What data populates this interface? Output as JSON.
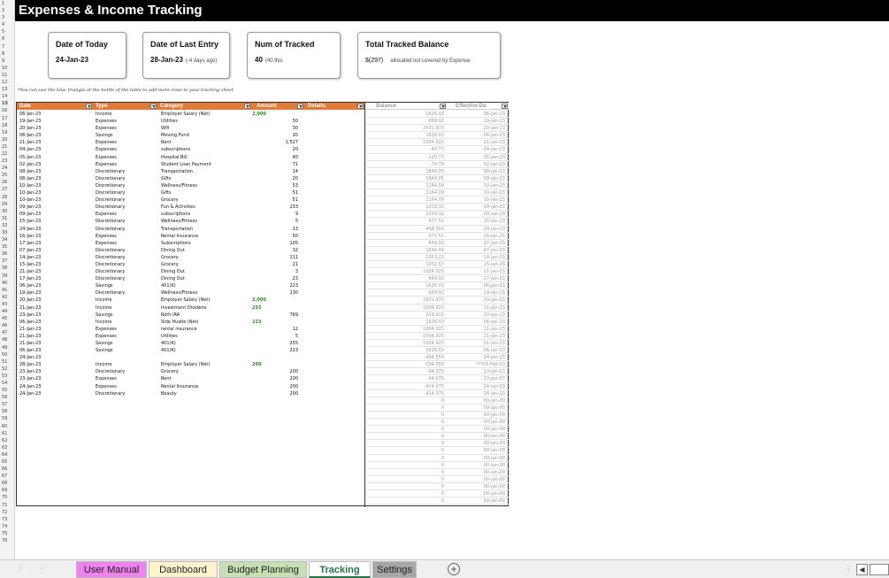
{
  "title": "Expenses & Income Tracking",
  "row_numbers": [
    "1",
    "2",
    "3",
    "4",
    "5",
    "6",
    "7",
    "8",
    "9",
    "10",
    "11",
    "12",
    "13",
    "14",
    "15",
    "16",
    "17",
    "18",
    "19",
    "20",
    "21",
    "22",
    "23",
    "24",
    "25",
    "26",
    "27",
    "28",
    "29",
    "30",
    "31",
    "32",
    "33",
    "34",
    "35",
    "36",
    "37",
    "38",
    "39",
    "40",
    "41",
    "42",
    "43",
    "44",
    "45",
    "46",
    "47",
    "48",
    "49",
    "50",
    "51",
    "52",
    "53",
    "54",
    "55",
    "56",
    "57",
    "58",
    "59",
    "60",
    "61",
    "62",
    "63",
    "64",
    "65",
    "66",
    "67",
    "68",
    "69",
    "70",
    "71",
    "72",
    "73",
    "74",
    "75",
    "76"
  ],
  "cards": {
    "today": {
      "label": "Date of Today",
      "value": "24-Jan-23"
    },
    "last_entry": {
      "label": "Date of Last Entry",
      "value": "28-Jan-23",
      "sub": "(-4 days ago)"
    },
    "num_tracked": {
      "label": "Num of Tracked",
      "value": "40",
      "sub": "(40 this"
    },
    "balance": {
      "label": "Total Tracked Balance",
      "value": "$(297)",
      "sub": "allocated not covered by Expense"
    }
  },
  "note": "*You can use the blue triangle at the bottle of the table to add more rows to your tracking sheet",
  "table": {
    "headers": {
      "date": "Date",
      "type": "Type",
      "category": "Category",
      "amount": "Amount",
      "details": "Details",
      "balance": "Balance",
      "effective": "Effective Da"
    },
    "header_colors": {
      "main": "#e07b39",
      "aux": "#ffffff"
    },
    "rows": [
      {
        "date": "06-Jan-23",
        "type": "Income",
        "category": "Employer Salary (Net)",
        "amount": "2,000",
        "income": true,
        "balance": "1626.03",
        "effective": "06-Jan-23"
      },
      {
        "date": "19-Jan-23",
        "type": "Expenses",
        "category": "Utilities",
        "amount": "50",
        "balance": "669.92",
        "effective": "19-Jan-23"
      },
      {
        "date": "20-Jan-23",
        "type": "Expenses",
        "category": "Wifi",
        "amount": "30",
        "balance": "2631.975",
        "effective": "20-Jan-23"
      },
      {
        "date": "06-Jan-23",
        "type": "Savings",
        "category": "Moving Fund",
        "amount": "20",
        "balance": "1626.03",
        "effective": "06-Jan-23"
      },
      {
        "date": "21-Jan-23",
        "type": "Expenses",
        "category": "Rent",
        "amount": "1,527",
        "balance": "1004.925",
        "effective": "21-Jan-23"
      },
      {
        "date": "04-Jan-23",
        "type": "Expenses",
        "category": "subscriptions",
        "amount": "20",
        "balance": "-40.73",
        "effective": "04-Jan-23"
      },
      {
        "date": "05-Jan-23",
        "type": "Expenses",
        "category": "Hospital Bill",
        "amount": "40",
        "balance": "-120.73",
        "effective": "05-Jan-23"
      },
      {
        "date": "02-Jan-23",
        "type": "Expenses",
        "category": "Student Loan Payment",
        "amount": "71",
        "balance": "-70.79",
        "effective": "02-Jan-23"
      },
      {
        "date": "08-Jan-23",
        "type": "Discretionary",
        "category": "Transportation",
        "amount": "14",
        "balance": "1840.05",
        "effective": "08-Jan-23"
      },
      {
        "date": "08-Jan-23",
        "type": "Discretionary",
        "category": "Gifts",
        "amount": "20",
        "balance": "1840.05",
        "effective": "08-Jan-23"
      },
      {
        "date": "10-Jan-23",
        "type": "Discretionary",
        "category": "Wellness/Fitness",
        "amount": "53",
        "balance": "1164.09",
        "effective": "10-Jan-23"
      },
      {
        "date": "10-Jan-23",
        "type": "Discretionary",
        "category": "Gifts",
        "amount": "51",
        "balance": "1164.09",
        "effective": "10-Jan-23"
      },
      {
        "date": "10-Jan-23",
        "type": "Discretionary",
        "category": "Grocery",
        "amount": "51",
        "balance": "1164.09",
        "effective": "10-Jan-23"
      },
      {
        "date": "09-Jan-23",
        "type": "Discretionary",
        "category": "Fun & Activities",
        "amount": "233",
        "balance": "1319.32",
        "effective": "09-Jan-23"
      },
      {
        "date": "09-Jan-23",
        "type": "Expenses",
        "category": "subscriptions",
        "amount": "9",
        "balance": "1319.32",
        "effective": "09-Jan-23"
      },
      {
        "date": "15-Jan-23",
        "type": "Discretionary",
        "category": "Wellness/Fitness",
        "amount": "5",
        "balance": "977.51",
        "effective": "15-Jan-23"
      },
      {
        "date": "24-Jan-23",
        "type": "Discretionary",
        "category": "Transportation",
        "amount": "13",
        "balance": "-494.555",
        "effective": "24-Jan-23"
      },
      {
        "date": "16-Jan-23",
        "type": "Expenses",
        "category": "Rental Insurance",
        "amount": "50",
        "balance": "977.51",
        "effective": "16-Jan-23"
      },
      {
        "date": "17-Jan-23",
        "type": "Expenses",
        "category": "Subscriptions",
        "amount": "105",
        "balance": "849.92",
        "effective": "17-Jan-23"
      },
      {
        "date": "07-Jan-23",
        "type": "Discretionary",
        "category": "Dining Out",
        "amount": "32",
        "balance": "1594.44",
        "effective": "07-Jan-23"
      },
      {
        "date": "14-Jan-23",
        "type": "Discretionary",
        "category": "Grocery",
        "amount": "111",
        "balance": "1053.22",
        "effective": "14-Jan-23"
      },
      {
        "date": "15-Jan-23",
        "type": "Discretionary",
        "category": "Grocery",
        "amount": "21",
        "balance": "1032.57",
        "effective": "15-Jan-23"
      },
      {
        "date": "21-Jan-23",
        "type": "Discretionary",
        "category": "Dining Out",
        "amount": "3",
        "balance": "1004.925",
        "effective": "21-Jan-23"
      },
      {
        "date": "17-Jan-23",
        "type": "Discretionary",
        "category": "Dining Out",
        "amount": "23",
        "balance": "849.92",
        "effective": "17-Jan-23"
      },
      {
        "date": "06-Jan-23",
        "type": "Savings",
        "category": "401(K)",
        "amount": "223",
        "balance": "1626.03",
        "effective": "06-Jan-23"
      },
      {
        "date": "19-Jan-23",
        "type": "Discretionary",
        "category": "Wellness/Fitness",
        "amount": "130",
        "balance": "669.92",
        "effective": "19-Jan-23"
      },
      {
        "date": "20-Jan-23",
        "type": "Income",
        "category": "Employer Salary (Net)",
        "amount": "2,000",
        "income": true,
        "balance": "2631.975",
        "effective": "20-Jan-23"
      },
      {
        "date": "21-Jan-23",
        "type": "Income",
        "category": "Investment Dividens",
        "amount": "255",
        "income": true,
        "balance": "1004.925",
        "effective": "21-Jan-23"
      },
      {
        "date": "23-Jan-23",
        "type": "Savings",
        "category": "Roth IRA",
        "amount": "769",
        "balance": "219.925",
        "effective": "23-Jan-23"
      },
      {
        "date": "06-Jan-23",
        "type": "Income",
        "category": "Side Hustle (Net)",
        "amount": "223",
        "income": true,
        "balance": "1626.03",
        "effective": "06-Jan-23"
      },
      {
        "date": "21-Jan-23",
        "type": "Expenses",
        "category": "rental insurance",
        "amount": "12",
        "balance": "1004.925",
        "effective": "21-Jan-23"
      },
      {
        "date": "21-Jan-23",
        "type": "Expenses",
        "category": "Utilities",
        "amount": "5",
        "balance": "1004.925",
        "effective": "21-Jan-23"
      },
      {
        "date": "21-Jan-23",
        "type": "Savings",
        "category": "401(K)",
        "amount": "255",
        "balance": "1004.925",
        "effective": "21-Jan-23"
      },
      {
        "date": "06-Jan-23",
        "type": "Savings",
        "category": "401(K)",
        "amount": "223",
        "balance": "1626.03",
        "effective": "06-Jan-23"
      },
      {
        "date": "24-Jan-23",
        "type": "",
        "category": "",
        "amount": "",
        "balance": "-494.555",
        "effective": "24-Jan-23"
      },
      {
        "date": "28-Jan-23",
        "type": "Income",
        "category": "Employer Salary (Net)",
        "amount": "200",
        "income": true,
        "balance": "-294.555",
        "effective": "***01-Feb-23"
      },
      {
        "date": "23-Jan-23",
        "type": "Discretionary",
        "category": "Grocery",
        "amount": "200",
        "balance": "-94.075",
        "effective": "23-Jan-23"
      },
      {
        "date": "23-Jan-23",
        "type": "Expenses",
        "category": "Rent",
        "amount": "200",
        "balance": "-94.075",
        "effective": "23-Jan-23"
      },
      {
        "date": "24-Jan-23",
        "type": "Expenses",
        "category": "Rental Insurance",
        "amount": "200",
        "balance": "-414.075",
        "effective": "24-Jan-23"
      },
      {
        "date": "24-Jan-23",
        "type": "Discretionary",
        "category": "Beauty",
        "amount": "200",
        "balance": "-414.075",
        "effective": "24-Jan-23"
      },
      {
        "balance": "0",
        "effective": "00-Jan-00"
      },
      {
        "balance": "0",
        "effective": "00-Jan-00"
      },
      {
        "balance": "0",
        "effective": "00-Jan-00"
      },
      {
        "balance": "0",
        "effective": "00-Jan-00"
      },
      {
        "balance": "0",
        "effective": "00-Jan-00"
      },
      {
        "balance": "0",
        "effective": "00-Jan-00"
      },
      {
        "balance": "0",
        "effective": "00-Jan-00"
      },
      {
        "balance": "0",
        "effective": "00-Jan-00"
      },
      {
        "balance": "0",
        "effective": "00-Jan-00"
      },
      {
        "balance": "0",
        "effective": "00-Jan-00"
      },
      {
        "balance": "0",
        "effective": "00-Jan-00"
      },
      {
        "balance": "0",
        "effective": "00-Jan-00"
      },
      {
        "balance": "0",
        "effective": "00-Jan-00"
      },
      {
        "balance": "0",
        "effective": "00-Jan-00"
      },
      {
        "balance": "0",
        "effective": "00-Jan-00"
      }
    ]
  },
  "tabs": [
    {
      "label": "User Manual",
      "color": "#ee82ee"
    },
    {
      "label": "Dashboard",
      "color": "#fff3cd"
    },
    {
      "label": "Budget Planning",
      "color": "#c6e0b4"
    },
    {
      "label": "Tracking",
      "color": "#ffffff",
      "active": true
    },
    {
      "label": "Settings",
      "color": "#a6a6a6"
    }
  ],
  "icons": {
    "prev": "chevron-left-icon",
    "next": "chevron-right-icon",
    "add": "plus-circle-icon"
  },
  "add_symbol": "+",
  "prev_symbol": "‹",
  "next_symbol": "›",
  "scroll_symbol": "◀",
  "dots_symbol": "⋮"
}
